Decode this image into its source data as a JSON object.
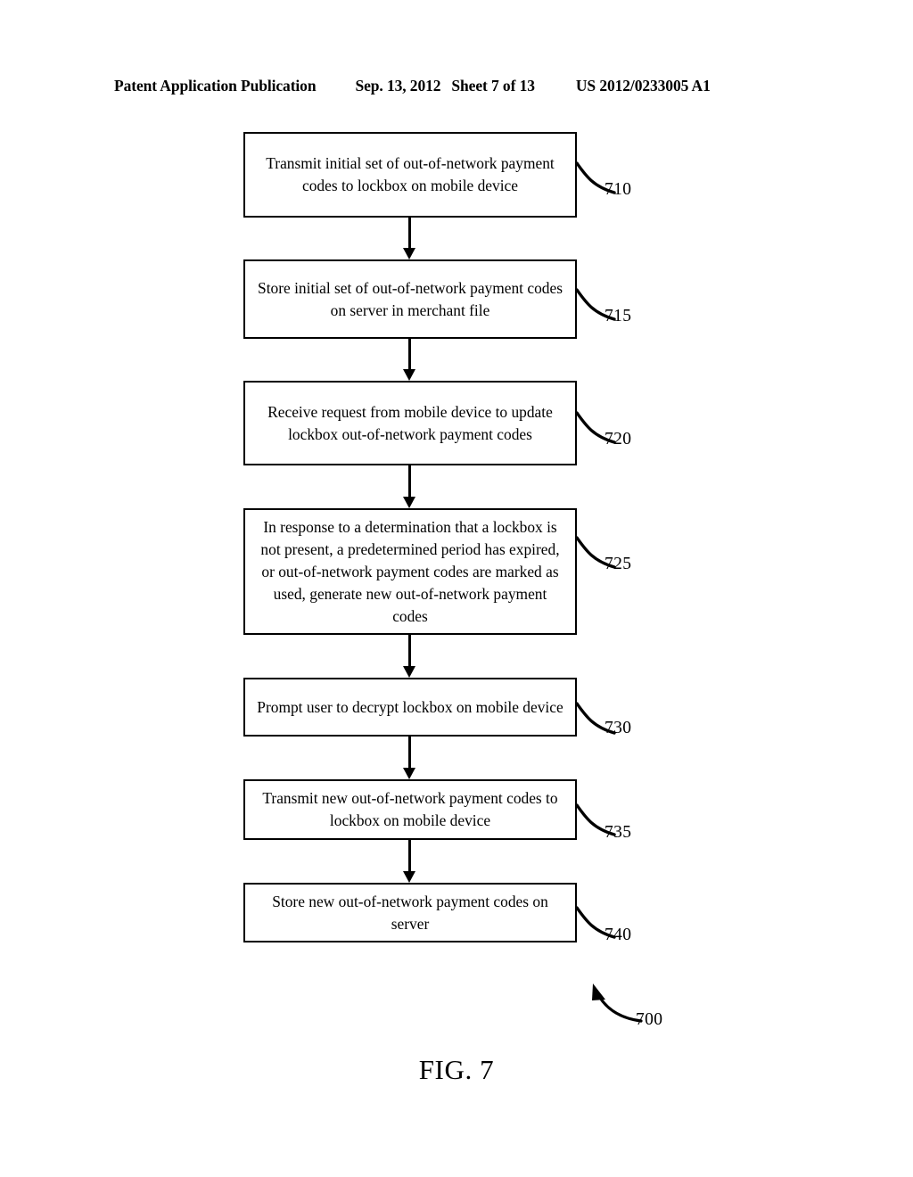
{
  "header": {
    "publication": "Patent Application Publication",
    "date": "Sep. 13, 2012",
    "sheet": "Sheet 7 of 13",
    "number": "US 2012/0233005 A1"
  },
  "figure": {
    "caption": "FIG. 7",
    "reference": "700",
    "type": "flowchart"
  },
  "flowchart": {
    "steps": [
      {
        "ref": "710",
        "text": "Transmit initial set of out-of-network payment codes to lockbox on mobile device"
      },
      {
        "ref": "715",
        "text": "Store initial set of out-of-network payment codes on server in merchant file"
      },
      {
        "ref": "720",
        "text": "Receive request from mobile device to update lockbox out-of-network payment codes"
      },
      {
        "ref": "725",
        "text": "In response to a determination that a lockbox is not present, a predetermined period has expired, or out-of-network payment codes are marked as used, generate new out-of-network payment codes"
      },
      {
        "ref": "730",
        "text": "Prompt user to decrypt lockbox on mobile device"
      },
      {
        "ref": "735",
        "text": "Transmit new out-of-network payment codes to lockbox on mobile device"
      },
      {
        "ref": "740",
        "text": "Store new out-of-network payment codes on server"
      }
    ]
  },
  "colors": {
    "ink": "#000000",
    "page": "#ffffff"
  }
}
